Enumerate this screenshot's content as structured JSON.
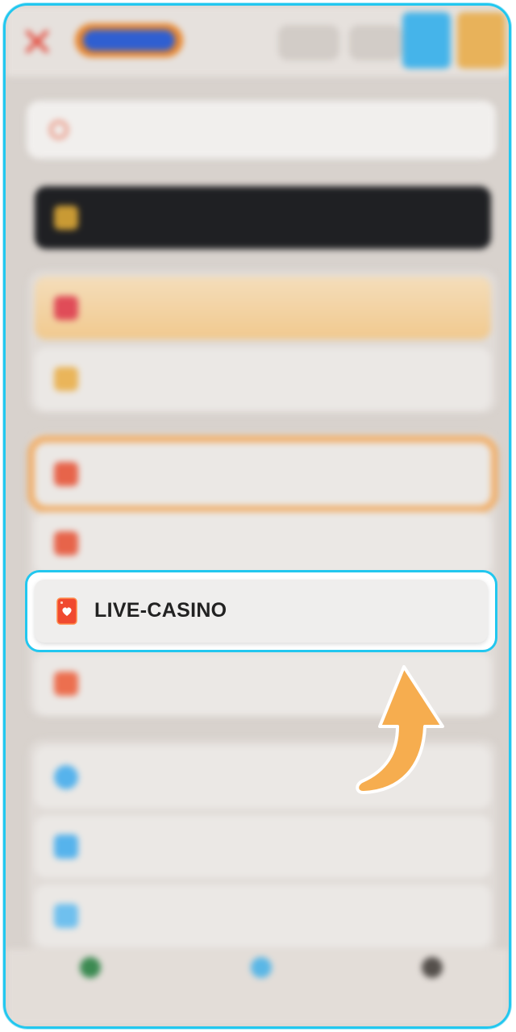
{
  "focused_menu_item": {
    "label": "LIVE-CASINO",
    "icon": "playing-card-icon"
  },
  "colors": {
    "focus_border": "#22c7ef",
    "accent_orange": "#e8862e",
    "arrow_fill": "#f6ad4f"
  },
  "annotation": {
    "icon": "curved-arrow-up-icon"
  }
}
